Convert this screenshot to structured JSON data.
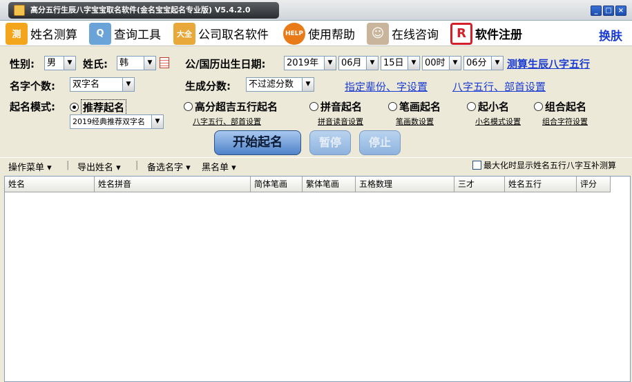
{
  "app": {
    "title": "高分五行生辰八字宝宝取名软件(金名宝宝起名专业版) V5.4.2.0",
    "window_buttons": [
      "minimize",
      "maximize",
      "close"
    ]
  },
  "menu": {
    "items": [
      {
        "label": "姓名测算",
        "icon": "name-test-icon",
        "icon_text": "测",
        "color": "#f3a61c"
      },
      {
        "label": "查询工具",
        "icon": "magnifier-icon",
        "icon_text": "Q",
        "color": "#6aa3d8"
      },
      {
        "label": "公司取名软件",
        "icon": "company-icon",
        "icon_text": "大全",
        "color": "#e8a83a"
      },
      {
        "label": "使用帮助",
        "icon": "help-icon",
        "icon_text": "HELP",
        "color": "#e87a18"
      },
      {
        "label": "在线咨询",
        "icon": "consultant-icon",
        "icon_text": "☺",
        "color": "#c9b59b"
      },
      {
        "label": "软件注册",
        "icon": "register-icon",
        "icon_text": "R",
        "color": "#d4202a"
      }
    ],
    "skin_label": "换肤"
  },
  "form": {
    "gender_label": "性别:",
    "gender_value": "男",
    "surname_label": "姓氏:",
    "surname_value": "韩",
    "birth_label": "公/国历出生日期:",
    "year": "2019年",
    "month": "06月",
    "day": "15日",
    "hour": "00时",
    "minute": "06分",
    "calc_bazi_link": "测算生辰八字五行",
    "name_count_label": "名字个数:",
    "name_count_value": "双字名",
    "score_label": "生成分数:",
    "score_value": "不过滤分数",
    "generation_link": "指定辈份、字设置",
    "bazi_radical_link": "八字五行、部首设置",
    "mode_label": "起名模式:",
    "modes": [
      {
        "label": "推荐起名",
        "selected": true,
        "sub": "2019经典推荐双字名"
      },
      {
        "label": "高分超吉五行起名",
        "selected": false,
        "sub": "八字五行、部首设置"
      },
      {
        "label": "拼音起名",
        "selected": false,
        "sub": "拼音读音设置"
      },
      {
        "label": "笔画起名",
        "selected": false,
        "sub": "笔画数设置"
      },
      {
        "label": "起小名",
        "selected": false,
        "sub": "小名模式设置"
      },
      {
        "label": "组合起名",
        "selected": false,
        "sub": "组合字符设置"
      }
    ],
    "start_button": "开始起名",
    "pause_button": "暂停",
    "stop_button": "停止"
  },
  "ops": {
    "items": [
      "操作菜单",
      "导出姓名",
      "备选名字",
      "黑名单"
    ],
    "checkbox_label": "最大化时显示姓名五行八字互补测算",
    "checkbox_checked": false
  },
  "table": {
    "columns": [
      "姓名",
      "姓名拼音",
      "简体笔画",
      "繁体笔画",
      "五格数理",
      "三才",
      "姓名五行",
      "评分"
    ],
    "rows": []
  }
}
